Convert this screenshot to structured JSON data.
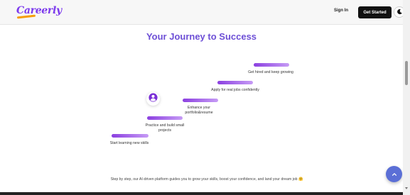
{
  "header": {
    "logo_text": "Careerly",
    "signin_label": "Sign In",
    "get_started_label": "Get Started",
    "theme_toggle_icon": "moon-icon"
  },
  "main": {
    "title": "Your Journey to Success",
    "steps": [
      {
        "label": "Start learning new skills"
      },
      {
        "label": "Practice and build small projects"
      },
      {
        "label": "Enhance your portfolio&resume"
      },
      {
        "label": "Apply for real jobs confidently"
      },
      {
        "label": "Get hired and keep growing"
      }
    ],
    "tagline": "Step by step, our AI-driven platform guides you to grow your skills, boost your confidence, and land your dream job 🤗"
  },
  "colors": {
    "accent": "#6d4fd6",
    "bar_start": "#8b3fe0",
    "bar_end": "#c69bf5",
    "fab": "#5b6fd6"
  },
  "icons": {
    "user_badge": "user-circle-icon",
    "fab": "chevron-up-icon"
  }
}
